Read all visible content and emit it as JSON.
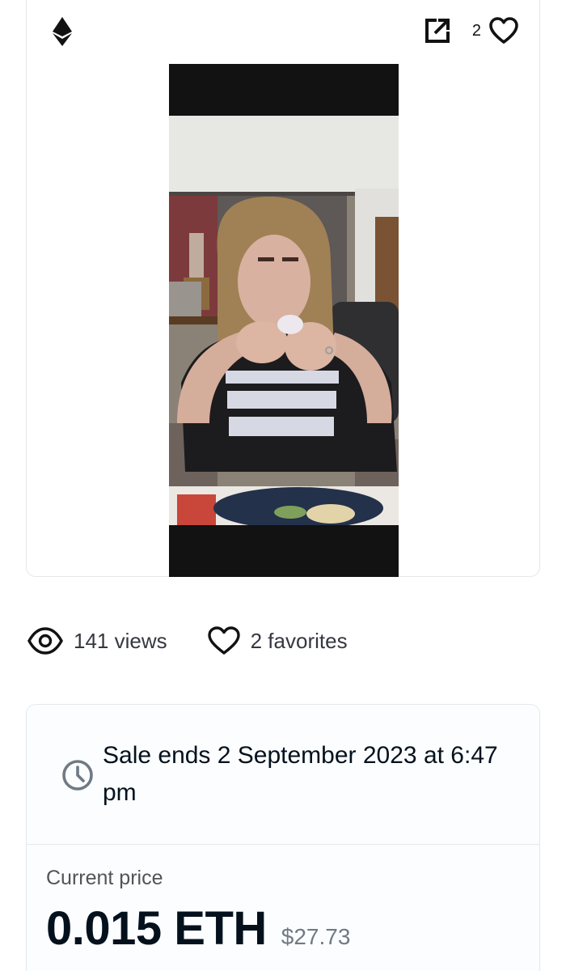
{
  "media_card": {
    "chain_icon": "ethereum-icon",
    "action_icon": "external-link-icon",
    "favorites_count": "2",
    "favorite_icon": "heart-outline-icon"
  },
  "stats": {
    "views": "141 views",
    "favorites": "2 favorites"
  },
  "sale": {
    "clock_icon": "clock-icon",
    "ends_text": "Sale ends 2 September 2023 at 6:47 pm"
  },
  "price": {
    "label": "Current price",
    "eth": "0.015 ETH",
    "usd": "$27.73"
  },
  "colors": {
    "border": "#e5e8eb",
    "text_primary": "#04111d",
    "text_secondary": "#707a83",
    "media_background": "#121212"
  }
}
